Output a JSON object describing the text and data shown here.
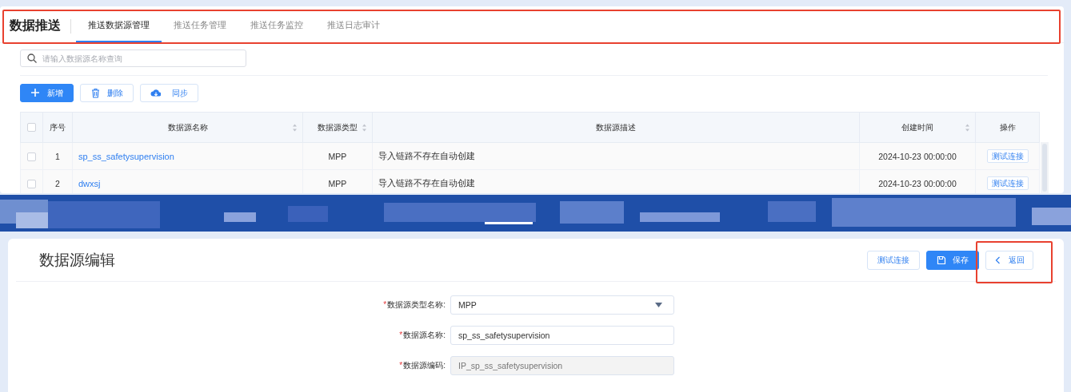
{
  "list_page": {
    "title": "数据推送",
    "highlighted": true,
    "tabs": [
      {
        "label": "推送数据源管理",
        "selected": true
      },
      {
        "label": "推送任务管理",
        "selected": false
      },
      {
        "label": "推送任务监控",
        "selected": false
      },
      {
        "label": "推送日志审计",
        "selected": false
      }
    ],
    "search": {
      "placeholder": "请输入数据源名称查询"
    },
    "toolbar": [
      {
        "kind": "add",
        "label": "新增"
      },
      {
        "kind": "delete",
        "label": "删除"
      },
      {
        "kind": "sync",
        "label": "同步"
      }
    ],
    "table": {
      "columns": [
        {
          "kind": "check",
          "checked": false
        },
        {
          "kind": "text",
          "label": "序号",
          "sortable": false
        },
        {
          "kind": "text",
          "label": "数据源名称",
          "sortable": true
        },
        {
          "kind": "text",
          "label": "数据源类型",
          "sortable": true
        },
        {
          "kind": "text",
          "label": "数据源描述",
          "sortable": false
        },
        {
          "kind": "text",
          "label": "创建时间",
          "sortable": true
        },
        {
          "kind": "text",
          "label": "操作",
          "sortable": false
        }
      ],
      "rows": [
        {
          "checked": false,
          "index": "1",
          "name": "sp_ss_safetysupervision",
          "type": "MPP",
          "description": "导入链路不存在自动创建",
          "created": "2024-10-23 00:00:00",
          "action": "测试连接"
        },
        {
          "checked": false,
          "index": "2",
          "name": "dwxsj",
          "type": "MPP",
          "description": "导入链路不存在自动创建",
          "created": "2024-10-23 00:00:00",
          "action": "测试连接"
        }
      ]
    }
  },
  "edit_page": {
    "title": "数据源编辑",
    "buttons": [
      {
        "kind": "plain",
        "label": "测试连接"
      },
      {
        "kind": "save",
        "label": "保存"
      },
      {
        "kind": "back",
        "label": "返回",
        "highlighted": true
      }
    ],
    "fields": [
      {
        "kind": "select",
        "required_mark": "*",
        "label": "数据源类型名称:",
        "value": "MPP"
      },
      {
        "kind": "input",
        "required_mark": "*",
        "label": "数据源名称:",
        "value": "sp_ss_safetysupervision"
      },
      {
        "kind": "readonly",
        "required_mark": "*",
        "label": "数据源编码:",
        "value": "IP_sp_ss_safetysupervision"
      }
    ]
  }
}
